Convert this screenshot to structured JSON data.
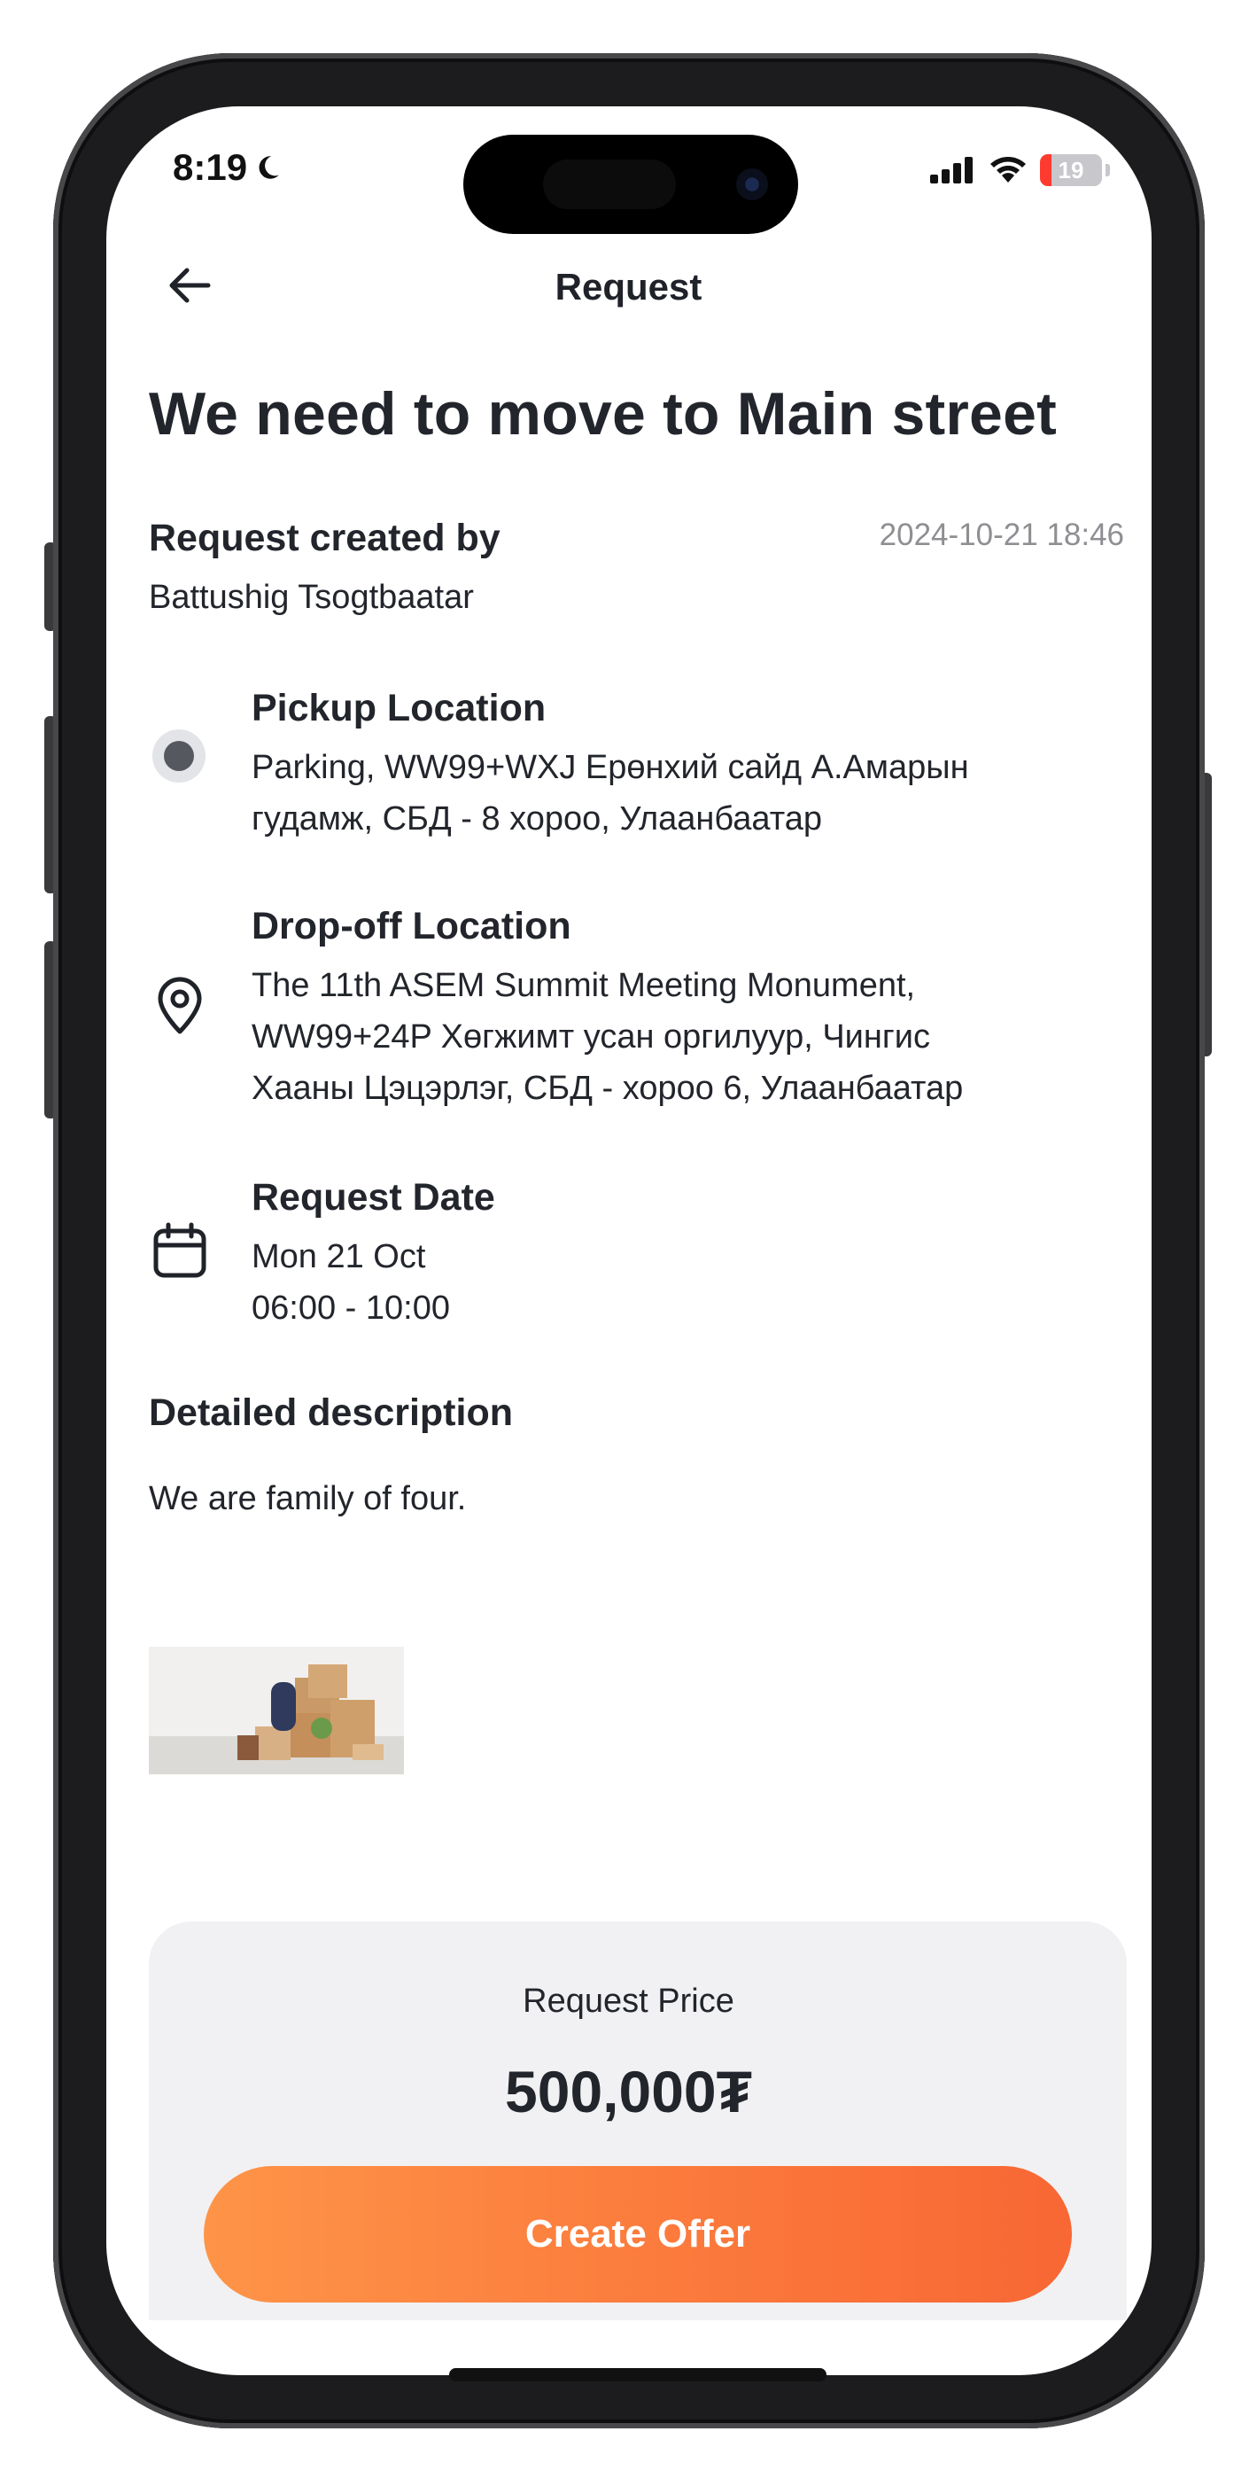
{
  "status_bar": {
    "time": "8:19",
    "battery": "19"
  },
  "nav": {
    "title": "Request",
    "back_icon": "arrow-left-icon"
  },
  "request": {
    "title": "We need to move to Main street",
    "created_label": "Request created by",
    "created_by": "Battushig Tsogtbaatar",
    "created_at": "2024-10-21 18:46",
    "pickup": {
      "label": "Pickup Location",
      "lines": [
        "Parking, WW99+WXJ Ерөнхий сайд А.Амарын",
        "гудамж, СБД - 8 хороо, Улаанбаатар"
      ]
    },
    "dropoff": {
      "label": "Drop-off Location",
      "lines": [
        "The 11th ASEM Summit Meeting Monument,",
        "WW99+24P Хөгжимт усан оргилуур, Чингис",
        "Хааны Цэцэрлэг, СБД - хороо 6, Улаанбаатар"
      ]
    },
    "date": {
      "label": "Request Date",
      "day": "Mon 21 Oct",
      "time_range": "06:00 - 10:00"
    },
    "description_label": "Detailed description",
    "description": "We are family of four."
  },
  "footer": {
    "price_label": "Request Price",
    "price": "500,000₮",
    "cta_label": "Create Offer"
  },
  "colors": {
    "accent_start": "#fe9448",
    "accent_end": "#f86734",
    "card_bg": "#f1f1f3",
    "muted": "#8e8e93"
  }
}
